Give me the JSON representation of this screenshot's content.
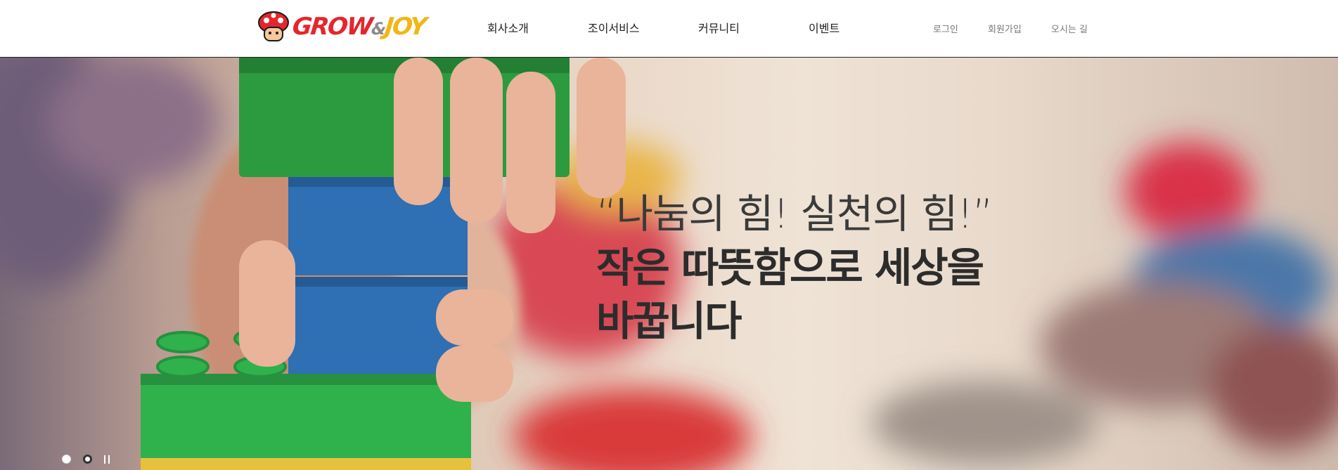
{
  "brand": {
    "logo_text_1": "GROW",
    "logo_text_2": "&",
    "logo_text_3": "JOY"
  },
  "nav": {
    "items": [
      {
        "label": "회사소개"
      },
      {
        "label": "조이서비스"
      },
      {
        "label": "커뮤니티"
      },
      {
        "label": "이벤트"
      }
    ]
  },
  "utility": {
    "login": "로그인",
    "signup": "회원가입",
    "directions": "오시는 길"
  },
  "hero": {
    "quote": "“나눔의 힘! 실천의 힘!”",
    "headline": "작은 따뜻함으로 세상을 바꿉니다"
  },
  "slider": {
    "slide_count": 2,
    "active_index": 0,
    "state": "playing"
  },
  "colors": {
    "logo_red": "#e3262d",
    "logo_yellow": "#f2b616",
    "logo_gray": "#8a8a8a",
    "header_border": "#222222"
  }
}
